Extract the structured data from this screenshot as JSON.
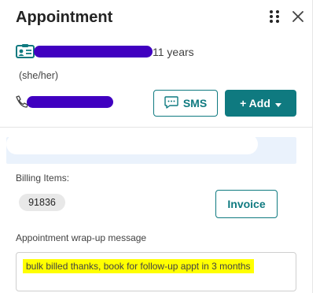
{
  "header": {
    "title": "Appointment"
  },
  "patient": {
    "age": "11 years",
    "pronouns": "(she/her)"
  },
  "actions": {
    "sms_label": "SMS",
    "add_label": "+ Add"
  },
  "billing": {
    "label": "Billing Items:",
    "items": [
      "91836"
    ],
    "invoice_label": "Invoice"
  },
  "wrapup": {
    "label": "Appointment wrap-up message",
    "message": "bulk billed thanks, book for follow-up appt in 3 months"
  },
  "icons": [
    "drag-handle-icon",
    "close-icon",
    "contact-card-icon",
    "phone-icon",
    "chat-icon",
    "chevron-down-icon"
  ],
  "colors": {
    "accent": "#0f7a80",
    "redaction": "#4000c0",
    "highlight": "#ffff00"
  }
}
